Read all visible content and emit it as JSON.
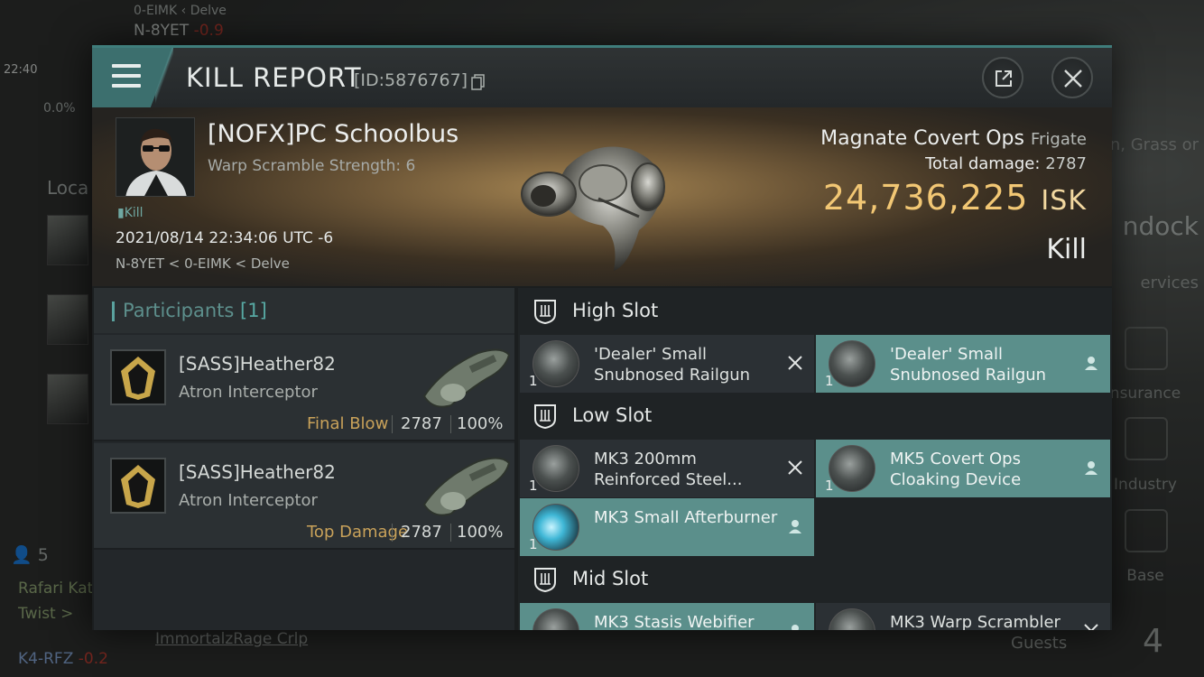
{
  "hud": {
    "sys_path": "0-EIMK  ‹ Delve",
    "system": "N-8YET",
    "system_sec": "-0.9",
    "clock": "22:40",
    "cargo_pct": "0.0%",
    "local_label": "Loca",
    "pilot_count": "5",
    "chat_1": "Rafari Kat",
    "chat_2": "Twist >",
    "chat_links": "ImmortalzRage  Crlp",
    "route_system": "K4-RFZ",
    "route_sec": "-0.2",
    "right_1": "n, Grass or",
    "right_2": "ndock",
    "right_3": "ervices",
    "insurance": "nsurance",
    "industry": "Industry",
    "base": "Base",
    "guests": "Guests",
    "guests_count": "4"
  },
  "modal": {
    "title": "KILL REPORT",
    "id": "[ID:5876767]",
    "victim": {
      "name": "[NOFX]PC Schoolbus",
      "warp": "Warp Scramble Strength: 6",
      "tag": "Kill",
      "date": "2021/08/14 22:34:06 UTC -6",
      "location": "N-8YET < 0-EIMK < Delve"
    },
    "ship": {
      "name": "Magnate Covert Ops",
      "class": "Frigate",
      "damage_label": "Total damage:",
      "damage": "2787",
      "isk": "24,736,225",
      "isk_unit": "ISK",
      "result": "Kill"
    },
    "participants": {
      "label": "Participants",
      "count": "[1]",
      "rows": [
        {
          "name": "[SASS]Heather82",
          "ship": "Atron Interceptor",
          "role": "Final Blow",
          "damage": "2787",
          "pct": "100%"
        },
        {
          "name": "[SASS]Heather82",
          "ship": "Atron Interceptor",
          "role": "Top Damage",
          "damage": "2787",
          "pct": "100%"
        }
      ]
    },
    "slots": {
      "high": "High Slot",
      "low": "Low Slot",
      "mid": "Mid Slot",
      "high_items": [
        {
          "qty": "1",
          "name": "'Dealer' Small Snubnosed Railgun",
          "state": "destroyed"
        },
        {
          "qty": "1",
          "name": "'Dealer' Small Snubnosed Railgun",
          "state": "dropped"
        }
      ],
      "low_items": [
        {
          "qty": "1",
          "name": "MK3 200mm Reinforced Steel...",
          "state": "destroyed"
        },
        {
          "qty": "1",
          "name": "MK5 Covert Ops Cloaking Device",
          "state": "dropped"
        },
        {
          "qty": "1",
          "name": "MK3 Small Afterburner",
          "state": "dropped"
        }
      ],
      "mid_items": [
        {
          "qty": "1",
          "name": "MK3 Stasis Webifier",
          "state": "dropped"
        },
        {
          "qty": "1",
          "name": "MK3 Warp Scrambler",
          "state": "destroyed"
        }
      ]
    }
  },
  "colors": {
    "accent": "#3c6f6e",
    "isk": "#f2c774",
    "fitted": "#5b8f8b",
    "final_blow": "#c9a25a"
  },
  "icons": [
    "menu-icon",
    "copy-icon",
    "external-link-icon",
    "close-icon",
    "shield-slot-icon",
    "destroyed-x-icon",
    "dropped-person-icon"
  ]
}
